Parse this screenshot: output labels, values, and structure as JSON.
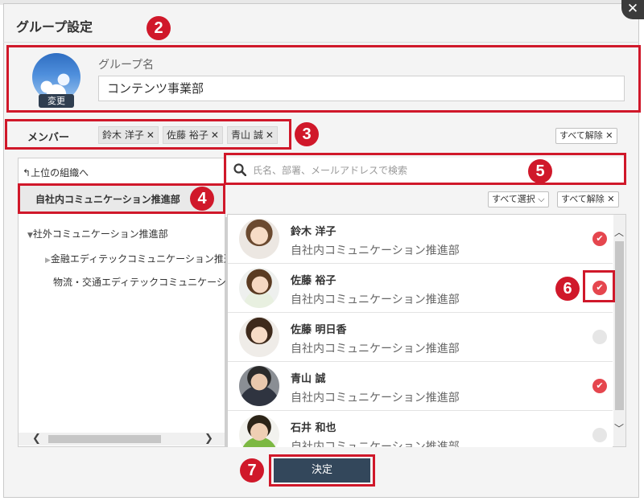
{
  "dialog": {
    "title": "グループ設定",
    "close_glyph": "✕",
    "decide_label": "決定"
  },
  "group": {
    "label": "グループ名",
    "value": "コンテンツ事業部",
    "change_label": "変更"
  },
  "members": {
    "label": "メンバー",
    "chips": [
      "鈴木 洋子",
      "佐藤 裕子",
      "青山 誠"
    ],
    "clear_all_label": "すべて解除"
  },
  "left_panel": {
    "up_label": "上位の組織へ",
    "selected_org": "自社内コミュニケーション推進部",
    "tree": [
      "社外コミュニケーション推進部",
      "金融エディテックコミュニケーション推進部",
      "物流・交通エディテックコミュニケーション推進部"
    ]
  },
  "search": {
    "placeholder": "氏名、部署、メールアドレスで検索"
  },
  "list_controls": {
    "select_all_label": "すべて選択",
    "clear_all_label": "すべて解除"
  },
  "people": [
    {
      "name": "鈴木 洋子",
      "dept": "自社内コミュニケーション推進部",
      "checked": true
    },
    {
      "name": "佐藤 裕子",
      "dept": "自社内コミュニケーション推進部",
      "checked": true
    },
    {
      "name": "佐藤 明日香",
      "dept": "自社内コミュニケーション推進部",
      "checked": false
    },
    {
      "name": "青山 誠",
      "dept": "自社内コミュニケーション推進部",
      "checked": true
    },
    {
      "name": "石井 和也",
      "dept": "自社内コミュニケーション推進部",
      "checked": false
    }
  ],
  "annotations": [
    "2",
    "3",
    "4",
    "5",
    "6",
    "7"
  ],
  "colors": {
    "accent_red": "#d0182a",
    "check_on": "#e5464e",
    "button_dark": "#33475b"
  }
}
